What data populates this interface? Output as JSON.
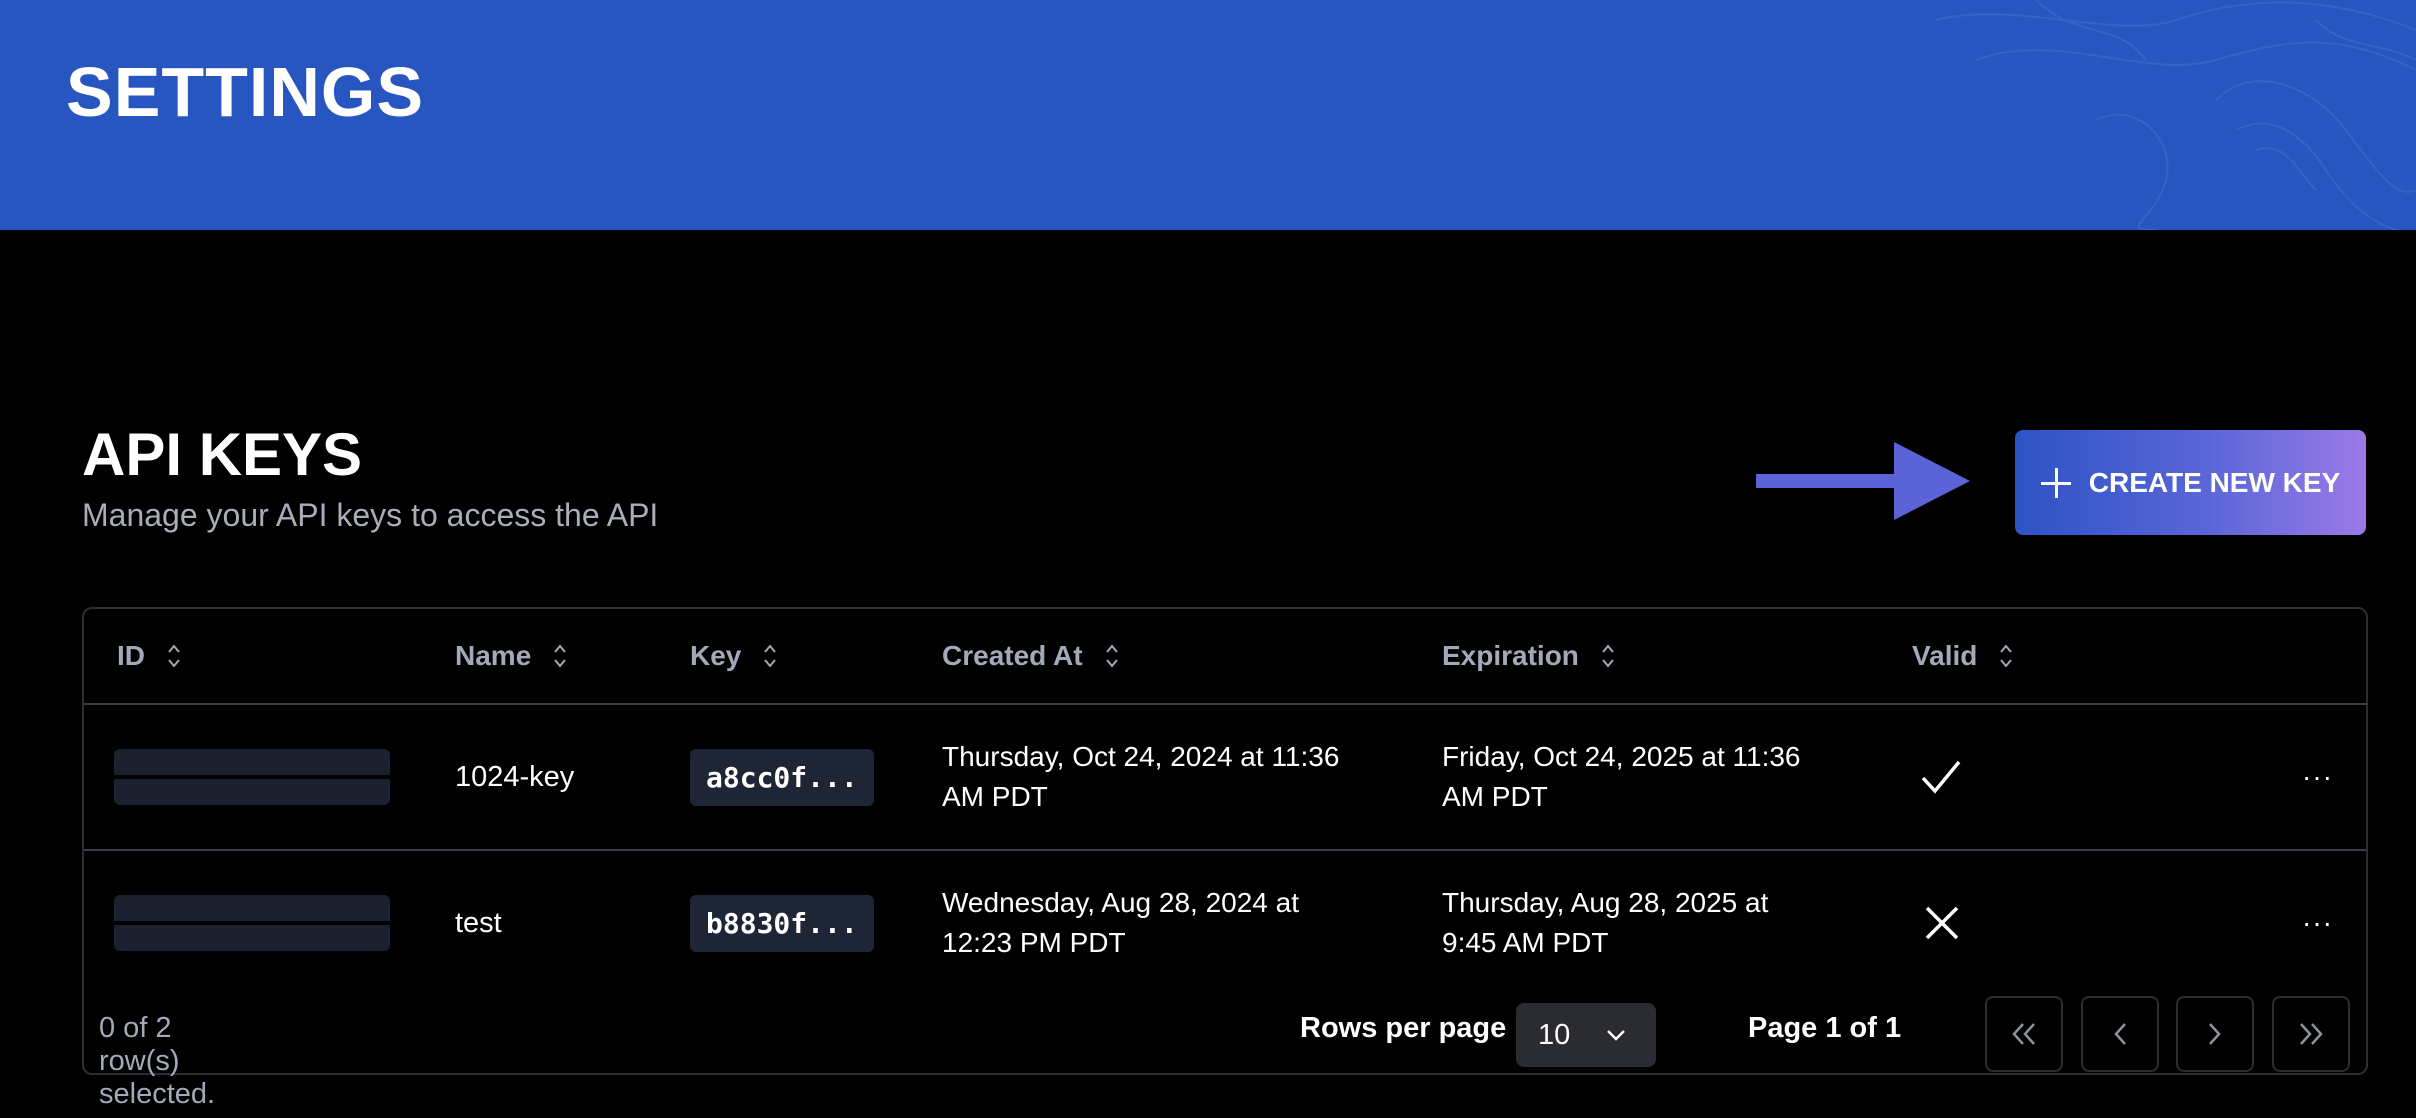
{
  "banner": {
    "title": "SETTINGS"
  },
  "section": {
    "title": "API KEYS",
    "subtitle": "Manage your API keys to access the API",
    "create_button": "CREATE NEW KEY"
  },
  "table": {
    "headers": {
      "id": "ID",
      "name": "Name",
      "key": "Key",
      "created": "Created At",
      "expiration": "Expiration",
      "valid": "Valid"
    },
    "rows": [
      {
        "name": "1024-key",
        "key": "a8cc0f...",
        "created_line1": "Thursday, Oct 24, 2024 at 11:36",
        "created_line2": "AM PDT",
        "expiration_line1": "Friday, Oct 24, 2025 at 11:36",
        "expiration_line2": "AM PDT",
        "valid_icon": "check-icon",
        "actions": "···"
      },
      {
        "name": "test",
        "key": "b8830f...",
        "created_line1": "Wednesday, Aug 28, 2024 at",
        "created_line2": "12:23 PM PDT",
        "expiration_line1": "Thursday, Aug 28, 2025 at",
        "expiration_line2": "9:45 AM PDT",
        "valid_icon": "x-icon",
        "actions": "···"
      }
    ]
  },
  "footer": {
    "selection": "0 of 2 row(s) selected.",
    "rows_per_page_label": "Rows per page",
    "rows_per_page_value": "10",
    "page_info": "Page 1 of 1"
  },
  "colors": {
    "banner": "#2856c0",
    "button_gradient_start": "#2d53c4",
    "button_gradient_end": "#9a7ae8",
    "arrow": "#5c63d6"
  }
}
